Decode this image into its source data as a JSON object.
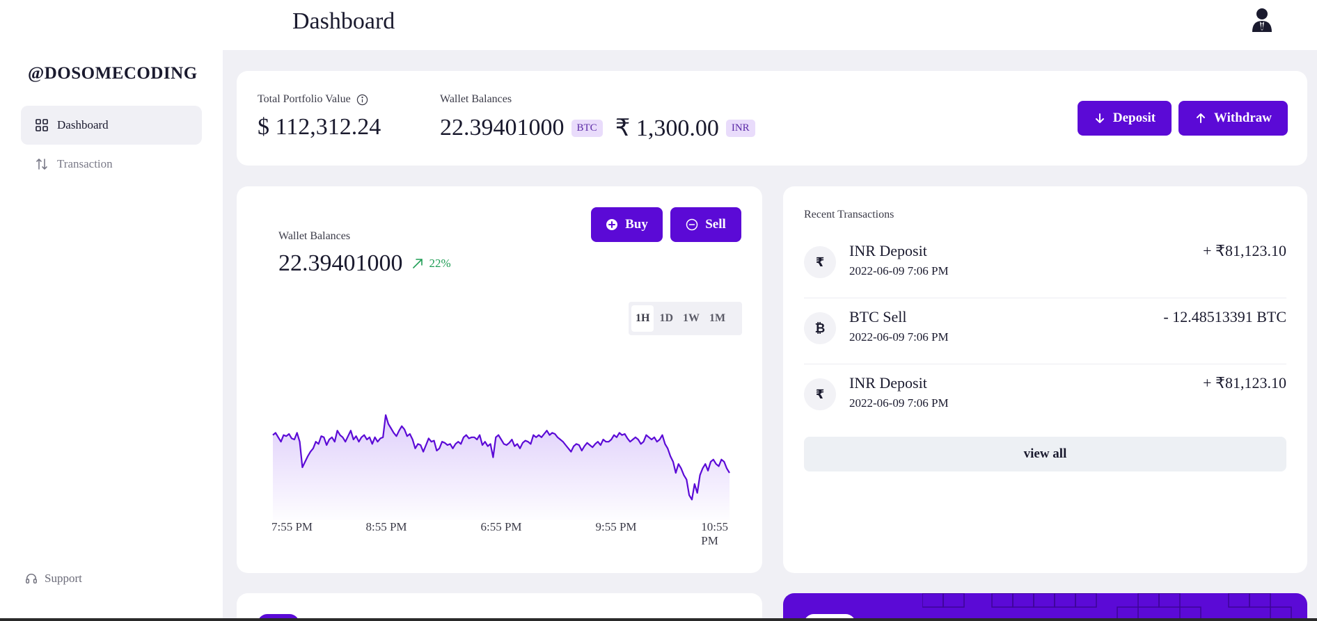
{
  "header": {
    "title": "Dashboard"
  },
  "sidebar": {
    "brand": "@DOSOMECODING",
    "items": [
      {
        "label": "Dashboard",
        "icon": "grid-icon",
        "active": true
      },
      {
        "label": "Transaction",
        "icon": "transfer-arrows-icon",
        "active": false
      }
    ],
    "support_label": "Support"
  },
  "summary": {
    "portfolio_label": "Total Portfolio Value",
    "portfolio_value": "$ 112,312.24",
    "wallet_label": "Wallet Balances",
    "btc_value": "22.39401000",
    "btc_unit": "BTC",
    "inr_value": "₹ 1,300.00",
    "inr_unit": "INR",
    "deposit_label": "Deposit",
    "withdraw_label": "Withdraw"
  },
  "chart_card": {
    "wallet_label": "Wallet Balances",
    "wallet_value": "22.39401000",
    "change": "22%",
    "buy_label": "Buy",
    "sell_label": "Sell",
    "timeframes": [
      "1H",
      "1D",
      "1W",
      "1M"
    ],
    "active_timeframe": "1H",
    "accent": "#5b0ad6",
    "positive_color": "#1f9d55"
  },
  "chart_data": {
    "type": "area",
    "x_ticks": [
      "7:55 PM",
      "8:55 PM",
      "6:55 PM",
      "9:55 PM",
      "10:55 PM"
    ],
    "values": [
      64,
      66,
      62,
      58,
      64,
      63,
      65,
      61,
      60,
      66,
      58,
      35,
      40,
      45,
      49,
      52,
      58,
      56,
      63,
      62,
      55,
      60,
      62,
      58,
      68,
      64,
      62,
      58,
      63,
      68,
      60,
      63,
      58,
      62,
      64,
      60,
      62,
      56,
      62,
      58,
      61,
      62,
      82,
      74,
      70,
      66,
      63,
      68,
      72,
      69,
      63,
      65,
      60,
      52,
      56,
      55,
      49,
      55,
      61,
      58,
      59,
      50,
      52,
      58,
      57,
      55,
      56,
      52,
      56,
      58,
      56,
      62,
      64,
      61,
      62,
      62,
      60,
      64,
      55,
      58,
      54,
      56,
      44,
      62,
      64,
      60,
      56,
      55,
      57,
      60,
      54,
      56,
      52,
      57,
      59,
      58,
      56,
      64,
      62,
      64,
      62,
      65,
      68,
      64,
      66,
      65,
      62,
      60,
      58,
      55,
      52,
      49,
      54,
      56,
      55,
      50,
      54,
      57,
      55,
      53,
      56,
      58,
      55,
      60,
      58,
      58,
      60,
      64,
      62,
      66,
      64,
      65,
      61,
      58,
      60,
      62,
      60,
      56,
      58,
      64,
      62,
      60,
      62,
      58,
      60,
      64,
      56,
      52,
      45,
      40,
      30,
      38,
      34,
      28,
      24,
      10,
      6,
      20,
      12,
      28,
      34,
      38,
      32,
      40,
      42,
      38,
      36,
      42,
      40,
      34,
      30
    ],
    "ylim": [
      0,
      100
    ]
  },
  "transactions": {
    "title": "Recent Transactions",
    "items": [
      {
        "icon": "₹",
        "icon_name": "rupee-icon",
        "title": "INR Deposit",
        "date": "2022-06-09 7:06 PM",
        "amount": "+ ₹81,123.10"
      },
      {
        "icon": "₿",
        "icon_name": "bitcoin-icon",
        "title": "BTC Sell",
        "date": "2022-06-09 7:06 PM",
        "amount": "- 12.48513391 BTC"
      },
      {
        "icon": "₹",
        "icon_name": "rupee-icon",
        "title": "INR Deposit",
        "date": "2022-06-09 7:06 PM",
        "amount": "+ ₹81,123.10"
      }
    ],
    "view_all_label": "view all"
  }
}
